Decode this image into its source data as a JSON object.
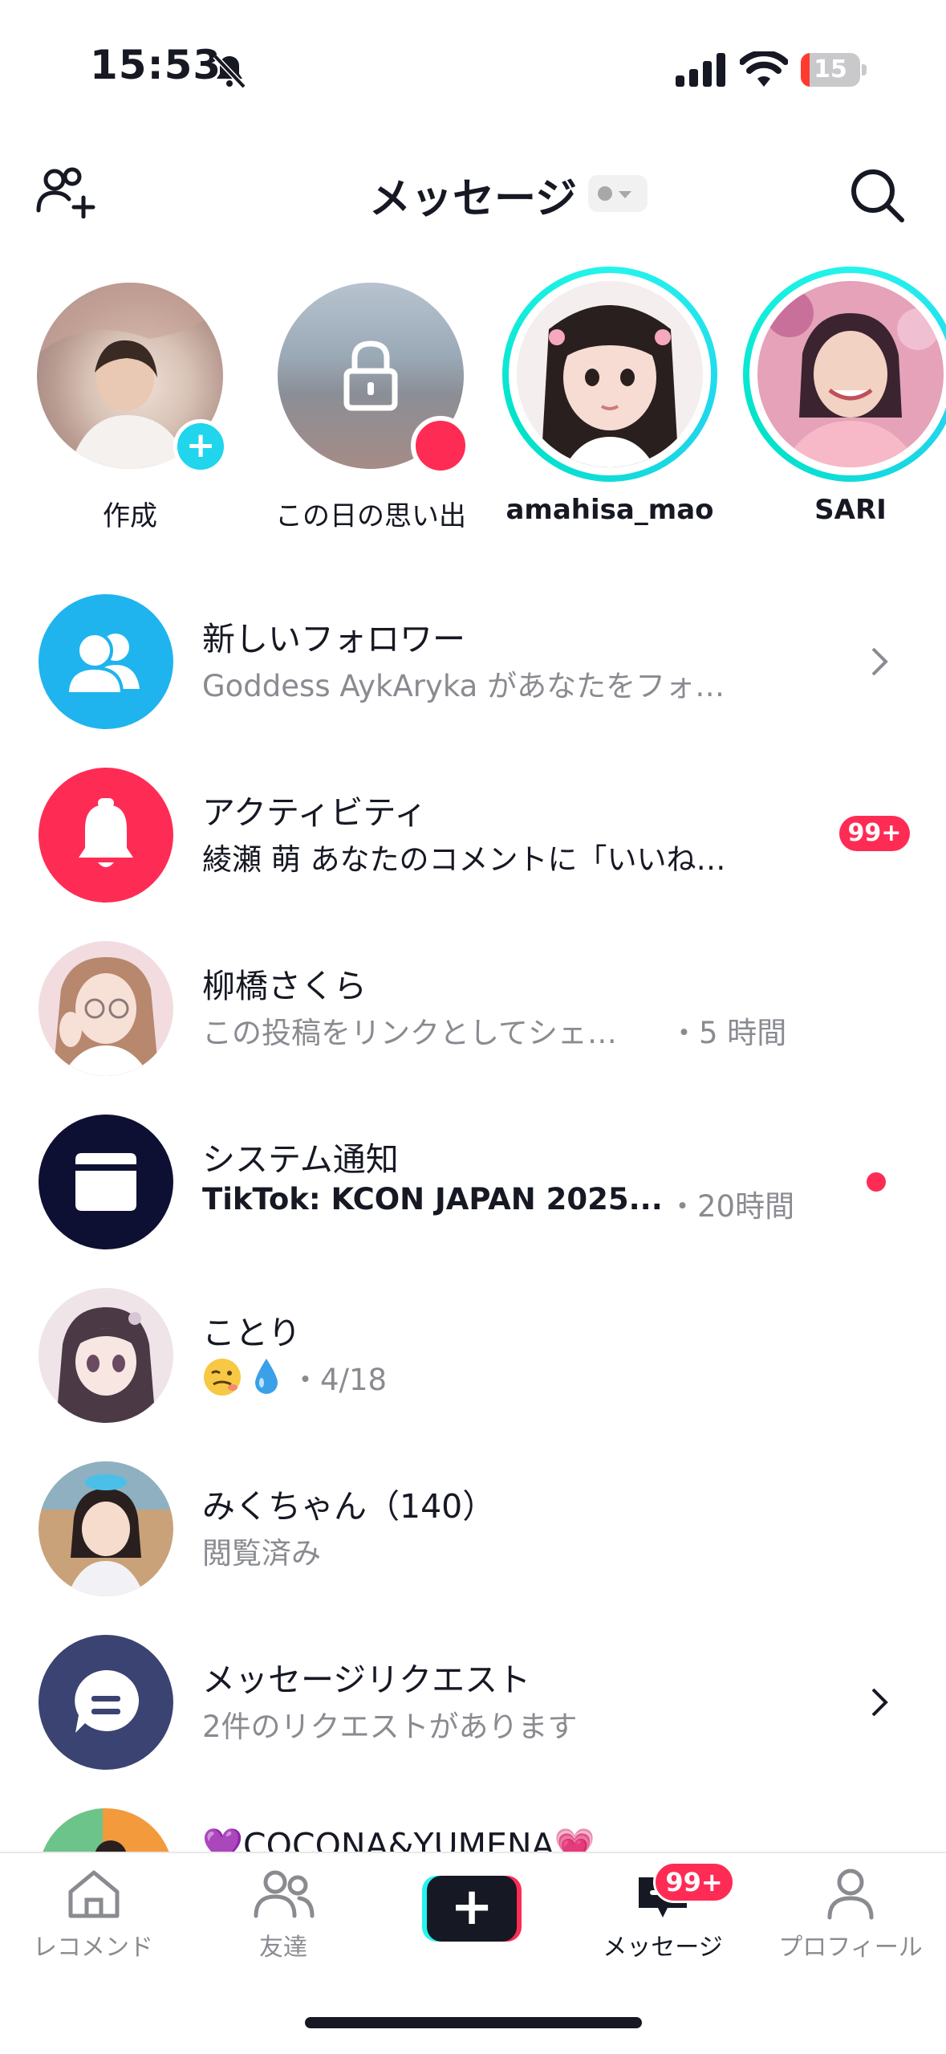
{
  "status_bar": {
    "time": "15:53",
    "battery": "15",
    "battery_level": 0.15
  },
  "header": {
    "title": "メッセージ",
    "add_friends_icon": "add-friends-icon",
    "search_icon": "search-icon"
  },
  "stories": [
    {
      "label": "作成"
    },
    {
      "label": "この日の思い出"
    },
    {
      "label": "amahisa_mao"
    },
    {
      "label": "SARI"
    }
  ],
  "rows": [
    {
      "title": "新しいフォロワー",
      "subtitle": "Goddess AykAryka があなたをフォ…",
      "icon": "followers-icon",
      "color": "#1fb4ee"
    },
    {
      "title": "アクティビティ",
      "subtitle": "綾瀬 萌 あなたのコメントに「いいね…",
      "badge": "99+",
      "icon": "bell-icon",
      "color": "#fe2c55"
    },
    {
      "title": "柳橋さくら",
      "subtitle": "この投稿をリンクとしてシェ…",
      "time": "・5 時間"
    },
    {
      "title": "システム通知",
      "subtitle": "TikTok: KCON JAPAN 2025...",
      "time": "・20時間",
      "icon": "inbox-icon",
      "color": "#0e1033"
    },
    {
      "title": "ことり",
      "subtitle": "・4/18"
    },
    {
      "title": "みくちゃん（140）",
      "subtitle": "閲覧済み"
    },
    {
      "title": "メッセージリクエスト",
      "subtitle": "2件のリクエストがあります",
      "icon": "chat-bubble-icon",
      "color": "#3a4372"
    },
    {
      "title": "💜COCONA&YUMENA💗"
    }
  ],
  "tabbar": {
    "items": [
      {
        "label": "レコメンド",
        "icon": "home-icon"
      },
      {
        "label": "友達",
        "icon": "friends-icon"
      },
      {
        "label": "",
        "icon": "create-icon"
      },
      {
        "label": "メッセージ",
        "icon": "inbox-tab-icon",
        "badge": "99+"
      },
      {
        "label": "プロフィール",
        "icon": "profile-icon"
      }
    ]
  }
}
